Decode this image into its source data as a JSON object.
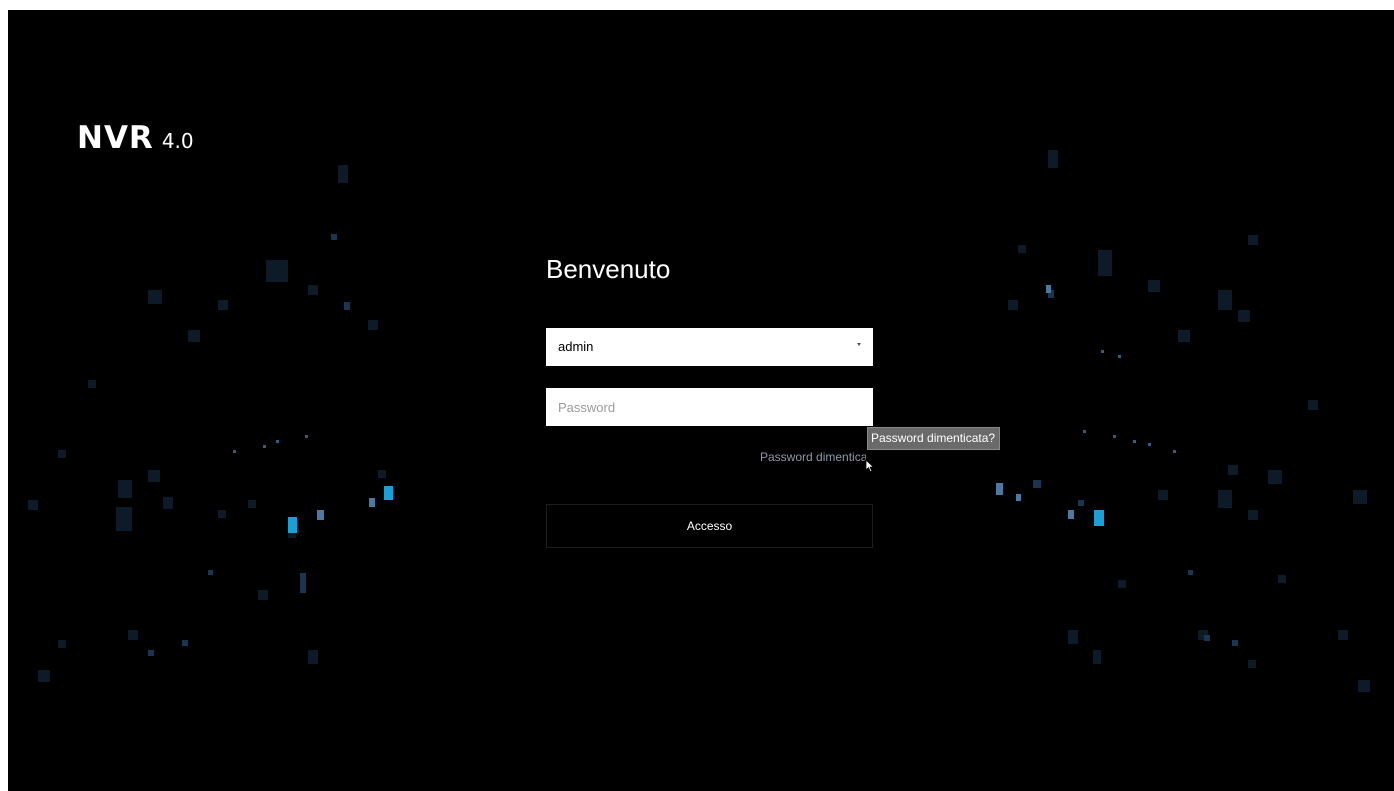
{
  "brand": {
    "name": "NVR",
    "version": "4.0"
  },
  "login": {
    "welcome": "Benvenuto",
    "user": {
      "selected": "admin"
    },
    "password": {
      "value": "",
      "placeholder": "Password"
    },
    "forgot_link": "Password dimenticata?",
    "forgot_tooltip": "Password dimenticata?",
    "submit_label": "Accesso"
  },
  "icons": {
    "dropdown": "chevron-down-icon",
    "cursor": "mouse-pointer-icon"
  },
  "colors": {
    "background": "#000000",
    "text": "#ffffff",
    "link": "#8f98a8",
    "tooltip_bg": "#6a6a6a",
    "accent_blue": "#1a9fd6"
  }
}
